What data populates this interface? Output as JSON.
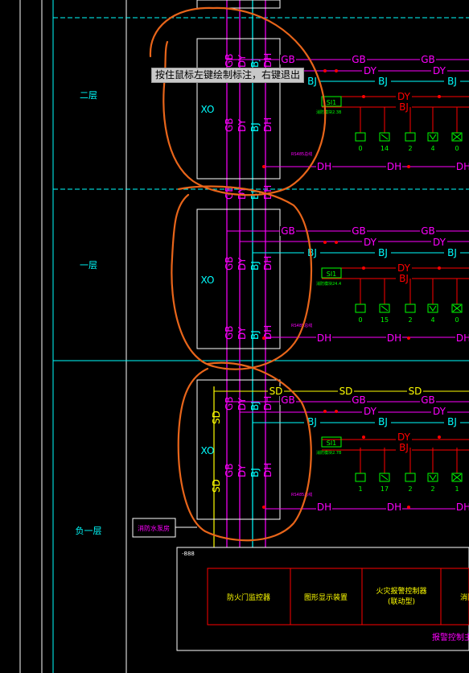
{
  "tooltip": "按住鼠标左键绘制标注，右键退出",
  "colors": {
    "background": "#000000",
    "cyan": "#00ffff",
    "white": "#ffffff",
    "magenta": "#ff00ff",
    "red": "#ff0000",
    "yellow": "#ffff00",
    "green": "#00ff00",
    "annotation": "#e8651a"
  },
  "floors": [
    {
      "label": "二层",
      "panel": "XO",
      "module": "SI1",
      "module_note": "消防模块2.3B",
      "bus_tag": "RS485总线",
      "devices": [
        "0",
        "14",
        "2",
        "4",
        "0"
      ],
      "device_icons": [
        "smoke-detector-icon",
        "manual-alarm-icon",
        "hydrant-button-icon",
        "heat-detector-icon",
        "valve-icon"
      ]
    },
    {
      "label": "一层",
      "panel": "XO",
      "module": "SI1",
      "module_note": "消防模块24.4",
      "bus_tag": "RS485总线",
      "devices": [
        "0",
        "15",
        "2",
        "4",
        "0"
      ],
      "device_icons": [
        "smoke-detector-icon",
        "manual-alarm-icon",
        "hydrant-button-icon",
        "heat-detector-icon",
        "flow-switch-icon"
      ]
    },
    {
      "label": "负一层",
      "panel": "XO",
      "module": "SI1",
      "module_note": "消防模块2.7B",
      "bus_tag": "RS485总线",
      "devices": [
        "1",
        "17",
        "2",
        "2",
        "1"
      ],
      "device_icons": [
        "smoke-detector-icon",
        "manual-alarm-icon",
        "hydrant-button-icon",
        "heat-detector-icon",
        "pressure-switch-icon"
      ]
    }
  ],
  "bus_labels": {
    "gb": "GB",
    "dy": "DY",
    "bj": "BJ",
    "dh": "DH",
    "sd": "SD"
  },
  "pump_box": "消防水泵房",
  "control_room": {
    "tag": "-888",
    "cells": [
      "防火门监控器",
      "图形显示装置",
      "火灾报警控制器\n(联动型)",
      "消防"
    ],
    "footer": "报警控制主机"
  }
}
